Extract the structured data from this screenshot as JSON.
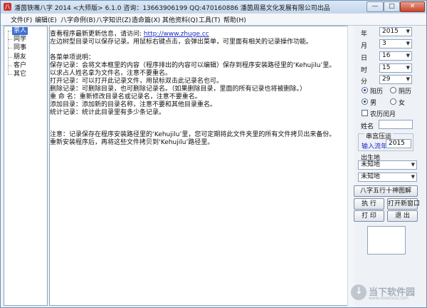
{
  "window": {
    "title": "潘茵铁嘴八字 2014  <大师版>    6.1.0    咨询：13663906199  QQ:470160886  潘茵周易文化发展有限公司出品",
    "min": "—",
    "max": "□",
    "close": "✕"
  },
  "menu": [
    "文件(F)",
    "编辑(E)",
    "八字命例(B)",
    "八字知识(Z)",
    "造命篇(X)",
    "其他资料(Q)",
    "工具(T)",
    "帮助(H)"
  ],
  "tree": {
    "items": [
      "亲人",
      "同学",
      "同事",
      "朋友",
      "客户",
      "其它"
    ],
    "selected_index": 0
  },
  "editor": {
    "line1_prefix": "查看程序最新更新信息，请访问: ",
    "line1_link": "http://www.zhuge.cc",
    "line2": "左边树型目录可以保存记录。用鼠标右键点击，会弹出菜单，可里面有相关的记录操作功能。",
    "line3": "各菜单项说明：",
    "line4": "保存记录：会将文本框里的内容（程序排出的内容可以编辑）保存到程序安装路径里的‘Kehujilu’里。",
    "line5": "          以求占人姓名拿为文件名，注意不要重名。",
    "line6": "打开记录：可以打开此记录文件，用鼠标双击此记录名也可。",
    "line7": "删除记录：可删除目录，也可删除记录名。（如果删除目录，里面的所有记录也将被删除。）",
    "line8": "重 命 名：重新修改目录名或记录名，注意不要重名。",
    "line9": "添加目录：添加新的目录名称，注意不要和其他目录重名。",
    "line10": "统计记录：统计此目录里有多少条记录。",
    "line11": "注意：记录保存在程序安装路径里的‘Kehujilu’里，您可定期将此文件夹里的所有文件拷贝出来备份。",
    "line12": "重新安装程序后，再将这些文件拷贝到‘Kehujilu’路径里。"
  },
  "panel": {
    "year_label": "年",
    "year_value": "2015",
    "month_label": "月",
    "month_value": "3",
    "day_label": "日",
    "day_value": "16",
    "hour_label": "时",
    "hour_value": "15",
    "minute_label": "分",
    "minute_value": "29",
    "solar_label": "阳历",
    "lunar_label": "阴历",
    "male_label": "男",
    "female_label": "女",
    "leap_label": "农历闰月",
    "name_label": "姓名",
    "name_value": "",
    "group_title": "串宫压运",
    "flow_year_label": "输入流年",
    "flow_year_value": "2015",
    "birthplace_label": "出生地",
    "birthplace_province": "未知地",
    "birthplace_city": "未知地",
    "btn_wuxing": "八字五行十神图解",
    "btn_execute": "执 行",
    "btn_new_window": "打开新窗口",
    "btn_print": "打 印",
    "btn_exit": "退 出"
  },
  "watermark": {
    "text": "当下软件园",
    "sub": "www.downxia.com"
  },
  "colors": {
    "selected_tree_bg": "#3d6fd4",
    "link": "#1a2bcc",
    "flow_year_label": "#1a2bcc"
  }
}
